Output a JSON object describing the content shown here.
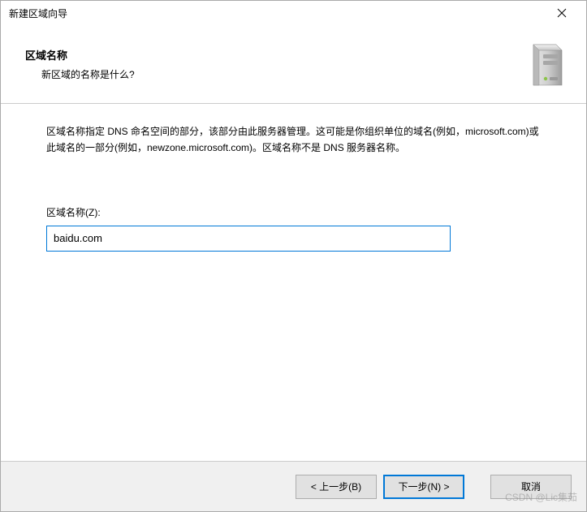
{
  "window": {
    "title": "新建区域向导"
  },
  "header": {
    "title": "区域名称",
    "subtitle": "新区域的名称是什么?"
  },
  "content": {
    "description": "区域名称指定 DNS 命名空间的部分，该部分由此服务器管理。这可能是你组织单位的域名(例如，microsoft.com)或此域名的一部分(例如，newzone.microsoft.com)。区域名称不是 DNS 服务器名称。",
    "input_label": "区域名称(Z):",
    "input_value": "baidu.com"
  },
  "footer": {
    "back_label": "< 上一步(B)",
    "next_label": "下一步(N) >",
    "cancel_label": "取消"
  },
  "watermark": "CSDN @Lic集茹"
}
